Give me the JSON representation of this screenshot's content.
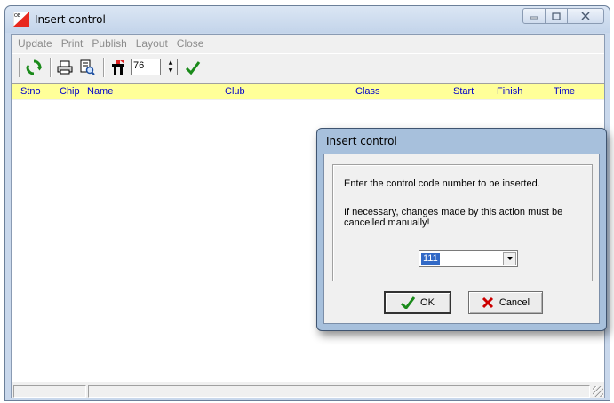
{
  "window": {
    "title": "Insert control",
    "logo_text": "OE",
    "menu": [
      "Update",
      "Print",
      "Publish",
      "Layout",
      "Close"
    ],
    "toolbar": {
      "icons": [
        "refresh-icon",
        "printer-icon",
        "print-preview-icon",
        "control-icon",
        "checkmark-icon"
      ],
      "spin_value": "76"
    },
    "grid_columns": [
      "Stno",
      "Chip",
      "Name",
      "Club",
      "Class",
      "Start",
      "Finish",
      "Time"
    ]
  },
  "dialog": {
    "title": "Insert control",
    "message": "Enter the control code number to be inserted.",
    "warning": "If necessary, changes made by this action must be cancelled manually!",
    "combo_value": "111",
    "ok_label": "OK",
    "cancel_label": "Cancel"
  },
  "colors": {
    "grid_header_bg": "#ffff99",
    "grid_header_text": "#0000cc",
    "accent_green": "#1a8a1a",
    "cancel_red": "#cc0000"
  }
}
